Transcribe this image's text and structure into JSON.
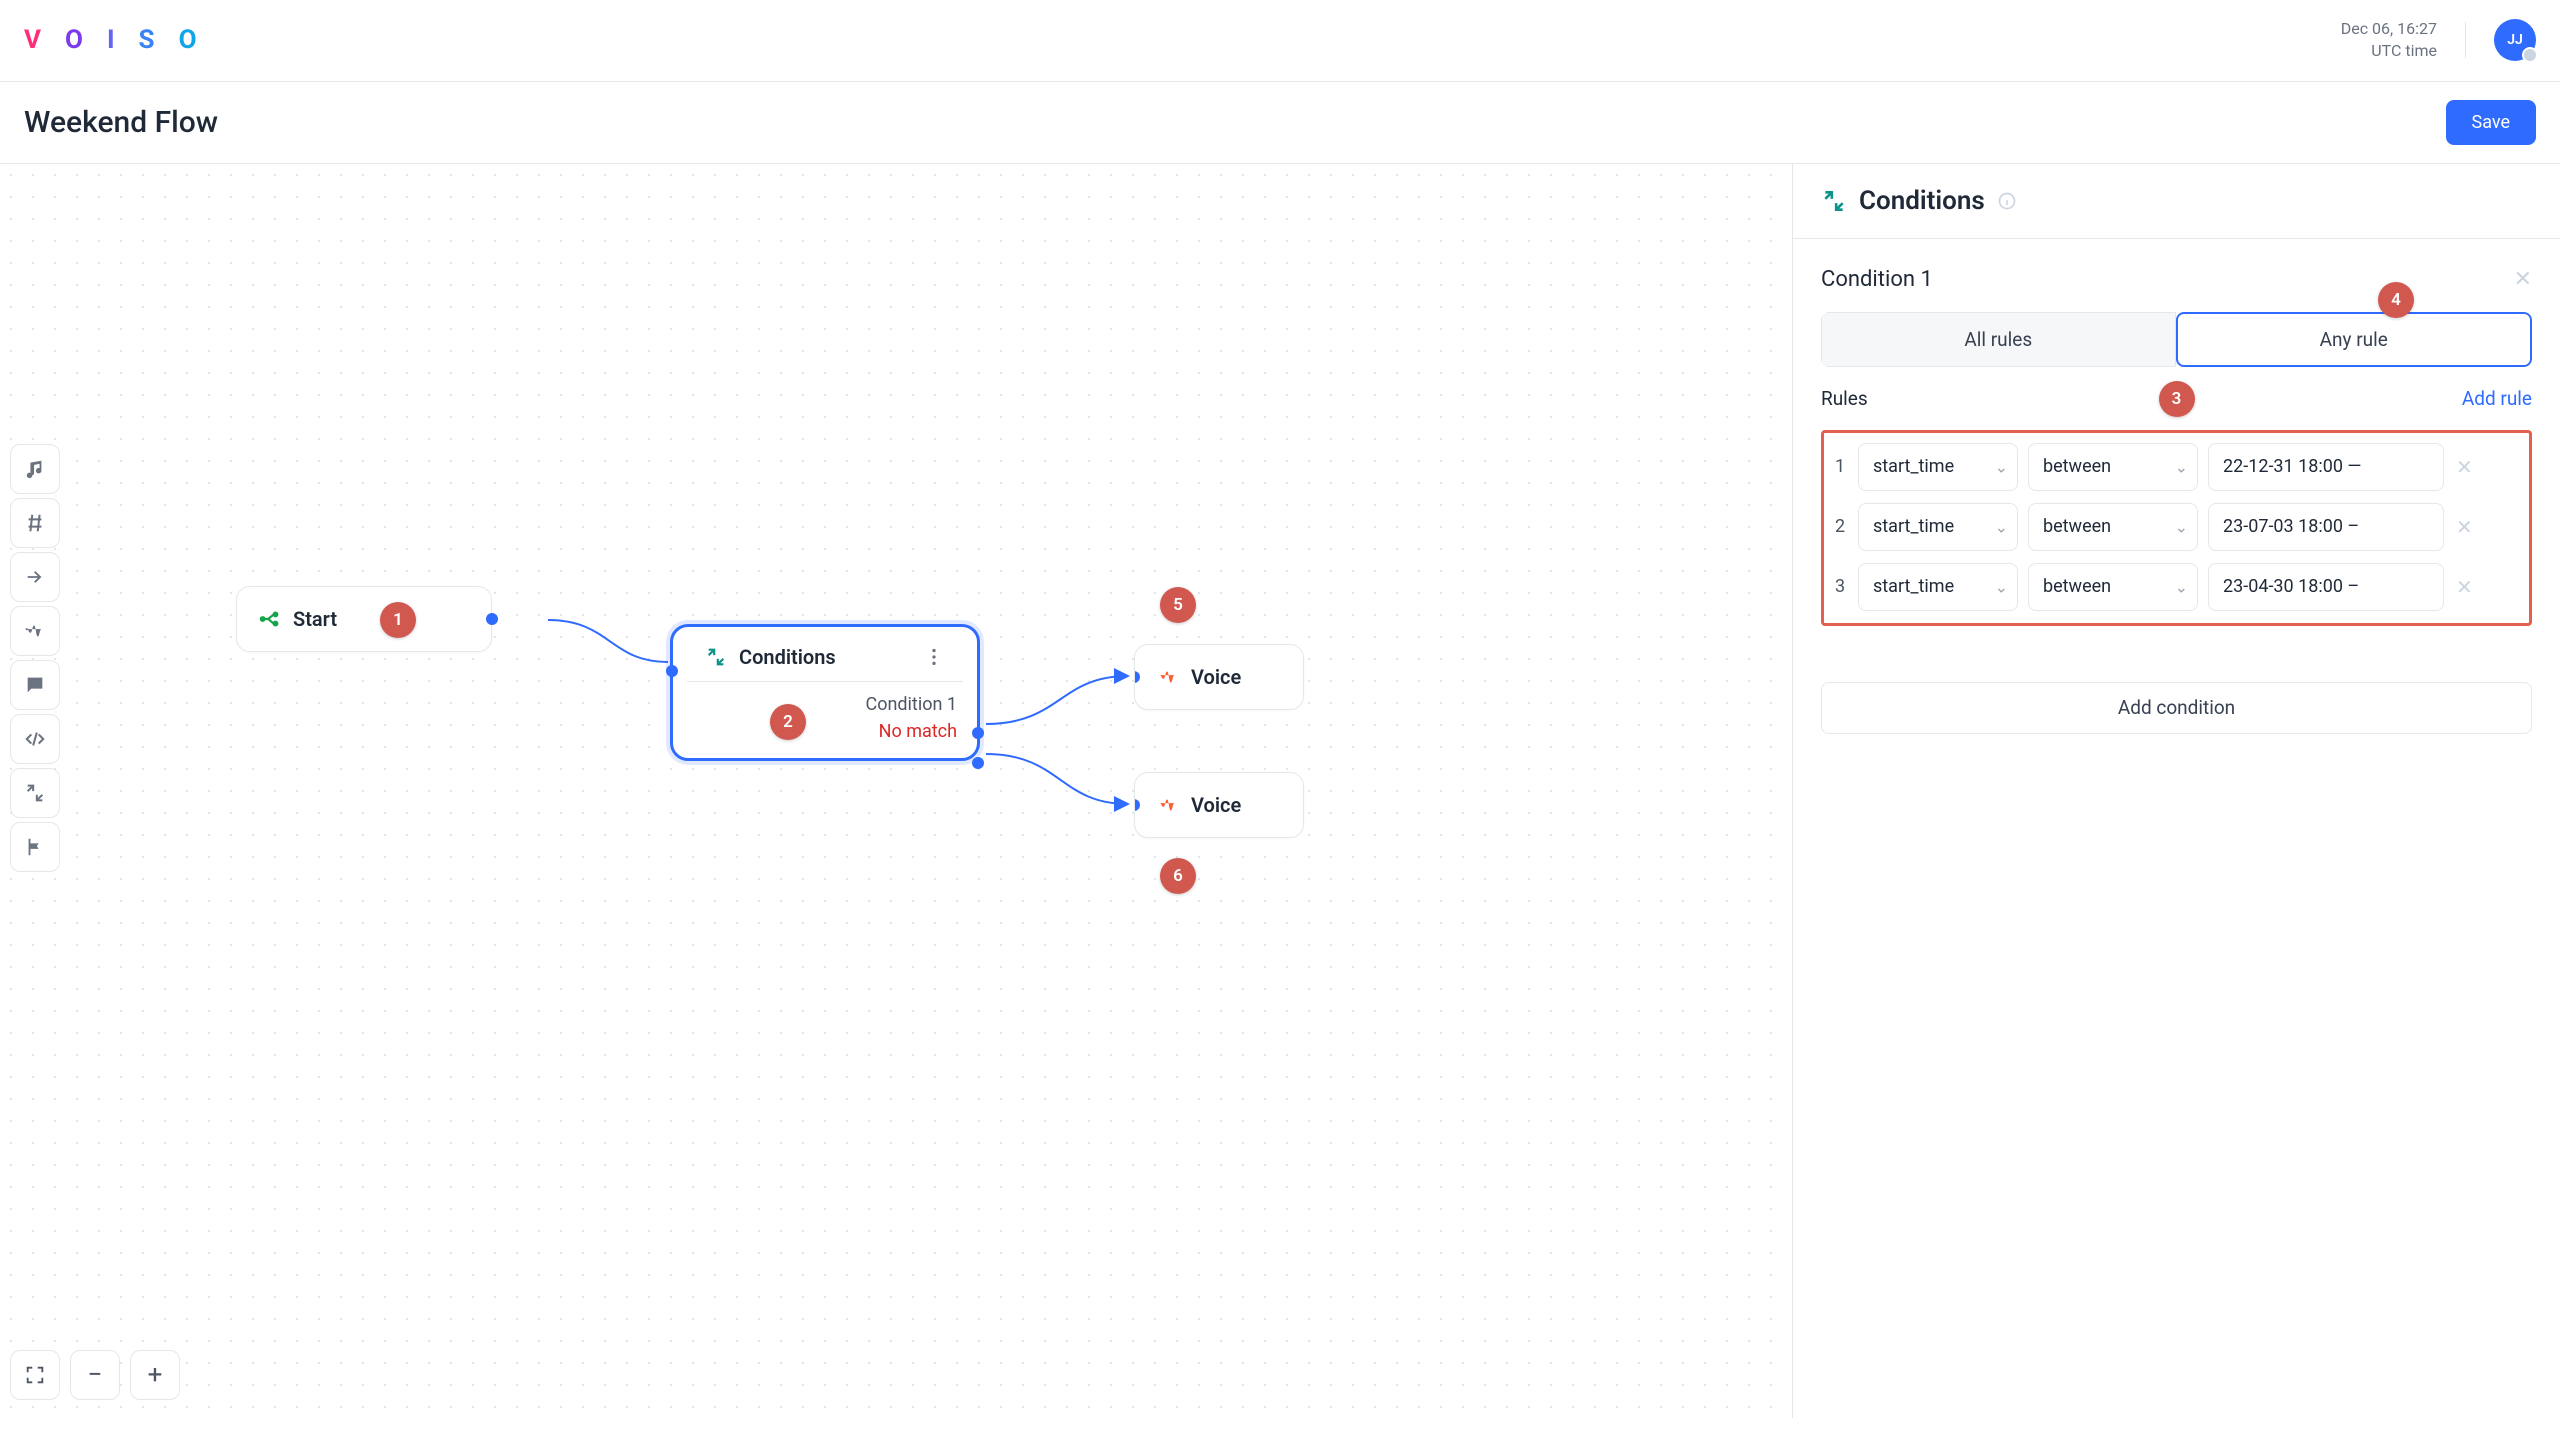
{
  "brand": {
    "letters": [
      "V",
      "O",
      "I",
      "S",
      "O"
    ]
  },
  "header": {
    "datetime": "Dec 06, 16:27",
    "tz": "UTC time",
    "avatar_initials": "JJ"
  },
  "titlebar": {
    "title": "Weekend Flow",
    "save_label": "Save"
  },
  "canvas": {
    "start_label": "Start",
    "cond_label": "Conditions",
    "cond_output1": "Condition 1",
    "cond_nomatch": "No match",
    "voice_label_a": "Voice",
    "voice_label_b": "Voice"
  },
  "panel": {
    "title": "Conditions",
    "condition_name": "Condition 1",
    "toggle_all": "All rules",
    "toggle_any": "Any rule",
    "rules_label": "Rules",
    "add_rule": "Add rule",
    "add_condition": "Add condition",
    "rules": [
      {
        "idx": "1",
        "field": "start_time",
        "op": "between",
        "value": "22-12-31 18:00 —"
      },
      {
        "idx": "2",
        "field": "start_time",
        "op": "between",
        "value": "23-07-03 18:00 –"
      },
      {
        "idx": "3",
        "field": "start_time",
        "op": "between",
        "value": "23-04-30 18:00 –"
      }
    ]
  },
  "callouts": {
    "c1": "1",
    "c2": "2",
    "c3": "3",
    "c4": "4",
    "c5": "5",
    "c6": "6"
  }
}
